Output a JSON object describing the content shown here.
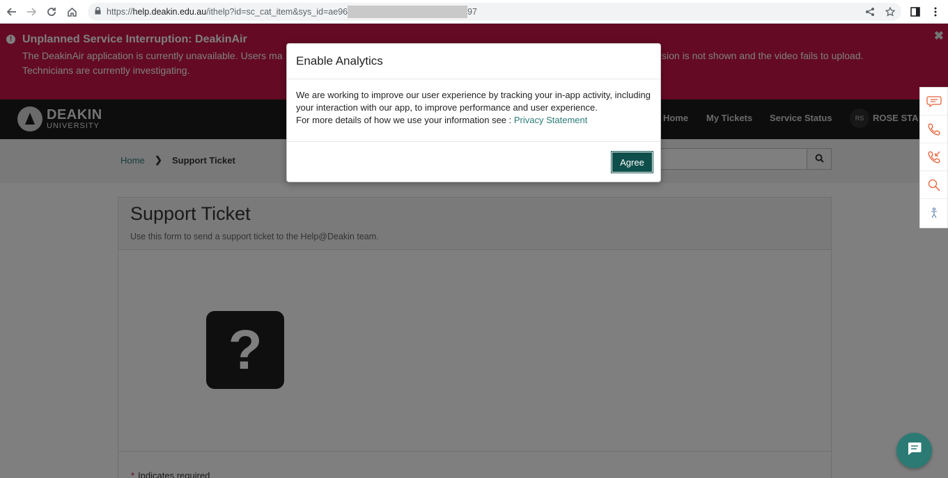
{
  "browser": {
    "url_prefix": "https://",
    "url_host": "help.deakin.edu.au",
    "url_path": "/ithelp?id=sc_cat_item&sys_id=ae96",
    "url_suffix": "97"
  },
  "alert": {
    "title": "Unplanned Service Interruption: DeakinAir",
    "body_line1": "The DeakinAir application is currently unavailable. Users ma",
    "body_line1_end": "sion is not shown and the video fails to upload.",
    "body_line2": "Technicians are currently investigating.",
    "close": "✖"
  },
  "header": {
    "logo_line1": "DEAKIN",
    "logo_line2": "UNIVERSITY",
    "nav": [
      "Home",
      "My Tickets",
      "Service Status"
    ],
    "avatar_initials": "RS",
    "user_name": "ROSE STA"
  },
  "breadcrumb": {
    "home": "Home",
    "separator": "❯",
    "current": "Support Ticket"
  },
  "page": {
    "title": "Support Ticket",
    "subtitle": "Use this form to send a support ticket to the Help@Deakin team.",
    "question_glyph": "?",
    "required_marker": "*",
    "required_text": "Indicates required"
  },
  "modal": {
    "title": "Enable Analytics",
    "body_line1": "We are working to improve our user experience by tracking your in-app activity, including",
    "body_line2": "your interaction with our app, to improve performance and user experience.",
    "body_line3": "For more details of how we use your information see : ",
    "link": "Privacy Statement",
    "agree": "Agree"
  },
  "colors": {
    "alert": "#c8144b",
    "accent": "#2a7b77",
    "button": "#0f4f4b",
    "sidebar_icons": "#e8623a"
  }
}
